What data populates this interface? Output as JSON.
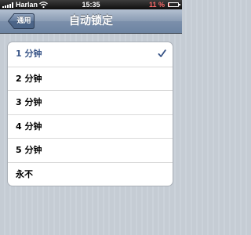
{
  "status_bar": {
    "carrier": "Harlan",
    "time": "15:35",
    "battery_percent": "11 %",
    "battery_level": 0.11,
    "battery_color": "#ff3b30"
  },
  "nav_bar": {
    "back_label": "通用",
    "title": "自动锁定"
  },
  "options": [
    {
      "label": "1 分钟",
      "selected": true
    },
    {
      "label": "2 分钟",
      "selected": false
    },
    {
      "label": "3 分钟",
      "selected": false
    },
    {
      "label": "4 分钟",
      "selected": false
    },
    {
      "label": "5 分钟",
      "selected": false
    },
    {
      "label": "永不",
      "selected": false
    }
  ],
  "icons": {
    "checkmark": "checkmark-icon",
    "wifi": "wifi-icon",
    "signal": "signal-icon",
    "battery": "battery-icon",
    "back": "back-arrow-icon"
  },
  "colors": {
    "selected_text": "#385487",
    "checkmark": "#385487"
  }
}
